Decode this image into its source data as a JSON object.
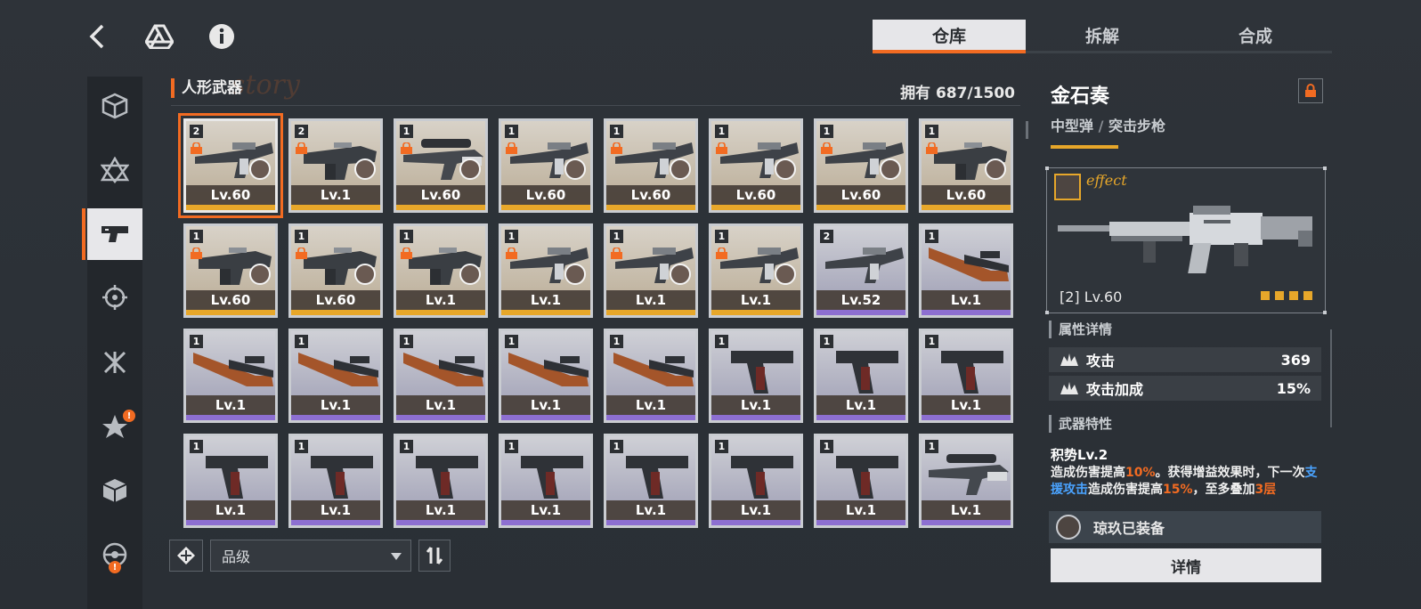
{
  "toolbar": {
    "back_icon": "back-arrow-icon",
    "drive_icon": "triangle-drive-icon",
    "info_icon": "info-icon"
  },
  "sidebar": {
    "items": [
      {
        "name": "box-icon",
        "active": false
      },
      {
        "name": "star-triangle-icon",
        "active": false
      },
      {
        "name": "gun-icon",
        "active": true
      },
      {
        "name": "target-icon",
        "active": false
      },
      {
        "name": "cross-feather-icon",
        "active": false
      },
      {
        "name": "flower-icon",
        "active": false,
        "badge": "!"
      },
      {
        "name": "cube-icon",
        "active": false
      },
      {
        "name": "wheel-icon",
        "active": false,
        "badge": "!"
      }
    ]
  },
  "tabs": [
    "仓库",
    "拆解",
    "合成"
  ],
  "section": {
    "title": "人形武器",
    "owned": "拥有 687/1500",
    "script": "story"
  },
  "grid": [
    {
      "num": "2",
      "level": "Lv.60",
      "lock": true,
      "avatar": true,
      "rarity": "gold",
      "selected": true,
      "weapon": "rifle"
    },
    {
      "num": "2",
      "level": "Lv.1",
      "lock": true,
      "avatar": true,
      "rarity": "gold",
      "weapon": "smg"
    },
    {
      "num": "1",
      "level": "Lv.60",
      "lock": true,
      "avatar": true,
      "rarity": "gold",
      "weapon": "sniper"
    },
    {
      "num": "1",
      "level": "Lv.60",
      "lock": true,
      "avatar": true,
      "rarity": "gold",
      "weapon": "rifle"
    },
    {
      "num": "1",
      "level": "Lv.60",
      "lock": true,
      "avatar": true,
      "rarity": "gold",
      "weapon": "rifle"
    },
    {
      "num": "1",
      "level": "Lv.60",
      "lock": true,
      "avatar": true,
      "rarity": "gold",
      "weapon": "rifle"
    },
    {
      "num": "1",
      "level": "Lv.60",
      "lock": true,
      "avatar": true,
      "rarity": "gold",
      "weapon": "rifle"
    },
    {
      "num": "1",
      "level": "Lv.60",
      "lock": true,
      "avatar": true,
      "rarity": "gold",
      "weapon": "smg"
    },
    {
      "num": "1",
      "level": "Lv.60",
      "lock": true,
      "avatar": true,
      "rarity": "gold",
      "weapon": "smg"
    },
    {
      "num": "1",
      "level": "Lv.60",
      "lock": true,
      "avatar": true,
      "rarity": "gold",
      "weapon": "smg"
    },
    {
      "num": "1",
      "level": "Lv.1",
      "lock": true,
      "avatar": true,
      "rarity": "gold",
      "weapon": "smg"
    },
    {
      "num": "1",
      "level": "Lv.1",
      "lock": true,
      "avatar": true,
      "rarity": "gold",
      "weapon": "rifle"
    },
    {
      "num": "1",
      "level": "Lv.1",
      "lock": true,
      "avatar": true,
      "rarity": "gold",
      "weapon": "rifle"
    },
    {
      "num": "1",
      "level": "Lv.1",
      "lock": true,
      "avatar": true,
      "rarity": "gold",
      "weapon": "rifle"
    },
    {
      "num": "2",
      "level": "Lv.52",
      "lock": false,
      "avatar": false,
      "rarity": "purple",
      "weapon": "rifle"
    },
    {
      "num": "1",
      "level": "Lv.1",
      "lock": false,
      "avatar": false,
      "rarity": "purple",
      "weapon": "wood"
    },
    {
      "num": "1",
      "level": "Lv.1",
      "lock": false,
      "avatar": false,
      "rarity": "purple",
      "weapon": "wood"
    },
    {
      "num": "1",
      "level": "Lv.1",
      "lock": false,
      "avatar": false,
      "rarity": "purple",
      "weapon": "wood"
    },
    {
      "num": "1",
      "level": "Lv.1",
      "lock": false,
      "avatar": false,
      "rarity": "purple",
      "weapon": "wood"
    },
    {
      "num": "1",
      "level": "Lv.1",
      "lock": false,
      "avatar": false,
      "rarity": "purple",
      "weapon": "wood"
    },
    {
      "num": "1",
      "level": "Lv.1",
      "lock": false,
      "avatar": false,
      "rarity": "purple",
      "weapon": "wood"
    },
    {
      "num": "1",
      "level": "Lv.1",
      "lock": false,
      "avatar": false,
      "rarity": "purple",
      "weapon": "pistol"
    },
    {
      "num": "1",
      "level": "Lv.1",
      "lock": false,
      "avatar": false,
      "rarity": "purple",
      "weapon": "pistol"
    },
    {
      "num": "1",
      "level": "Lv.1",
      "lock": false,
      "avatar": false,
      "rarity": "purple",
      "weapon": "pistol"
    },
    {
      "num": "1",
      "level": "Lv.1",
      "lock": false,
      "avatar": false,
      "rarity": "purple",
      "weapon": "pistol"
    },
    {
      "num": "1",
      "level": "Lv.1",
      "lock": false,
      "avatar": false,
      "rarity": "purple",
      "weapon": "pistol"
    },
    {
      "num": "1",
      "level": "Lv.1",
      "lock": false,
      "avatar": false,
      "rarity": "purple",
      "weapon": "pistol"
    },
    {
      "num": "1",
      "level": "Lv.1",
      "lock": false,
      "avatar": false,
      "rarity": "purple",
      "weapon": "pistol"
    },
    {
      "num": "1",
      "level": "Lv.1",
      "lock": false,
      "avatar": false,
      "rarity": "purple",
      "weapon": "pistol"
    },
    {
      "num": "1",
      "level": "Lv.1",
      "lock": false,
      "avatar": false,
      "rarity": "purple",
      "weapon": "pistol"
    },
    {
      "num": "1",
      "level": "Lv.1",
      "lock": false,
      "avatar": false,
      "rarity": "purple",
      "weapon": "pistol"
    },
    {
      "num": "1",
      "level": "Lv.1",
      "lock": false,
      "avatar": false,
      "rarity": "purple",
      "weapon": "sniper"
    }
  ],
  "controls": {
    "sort_label": "品级",
    "filter_icon": "filter-icon",
    "order_icon": "sort-order-icon"
  },
  "detail": {
    "name": "金石奏",
    "ammo": "中型弹",
    "sep": " / ",
    "class": "突击步枪",
    "preview_script": "effect",
    "preview_level": "[2] Lv.60",
    "stars": 4,
    "attr_head": "属性详情",
    "stats": [
      {
        "label": "攻击",
        "value": "369"
      },
      {
        "label": "攻击加成",
        "value": "15%"
      }
    ],
    "trait_head": "武器特性",
    "trait_name": "积势Lv.2",
    "trait_parts": [
      {
        "t": "造成伤害提高",
        "c": ""
      },
      {
        "t": "10%",
        "c": "o"
      },
      {
        "t": "。获得增益效果时，下一次",
        "c": ""
      },
      {
        "t": "支援攻击",
        "c": "b"
      },
      {
        "t": "造成伤害提高",
        "c": ""
      },
      {
        "t": "15%",
        "c": "o"
      },
      {
        "t": "，至多叠加",
        "c": ""
      },
      {
        "t": "3层",
        "c": "o"
      }
    ],
    "equipped_text": "琼玖已装备",
    "detail_button": "详情"
  },
  "colors": {
    "accent": "#f26b22",
    "gold": "#e7a72a",
    "purple": "#8d6fd1",
    "link": "#4aa3ff"
  }
}
